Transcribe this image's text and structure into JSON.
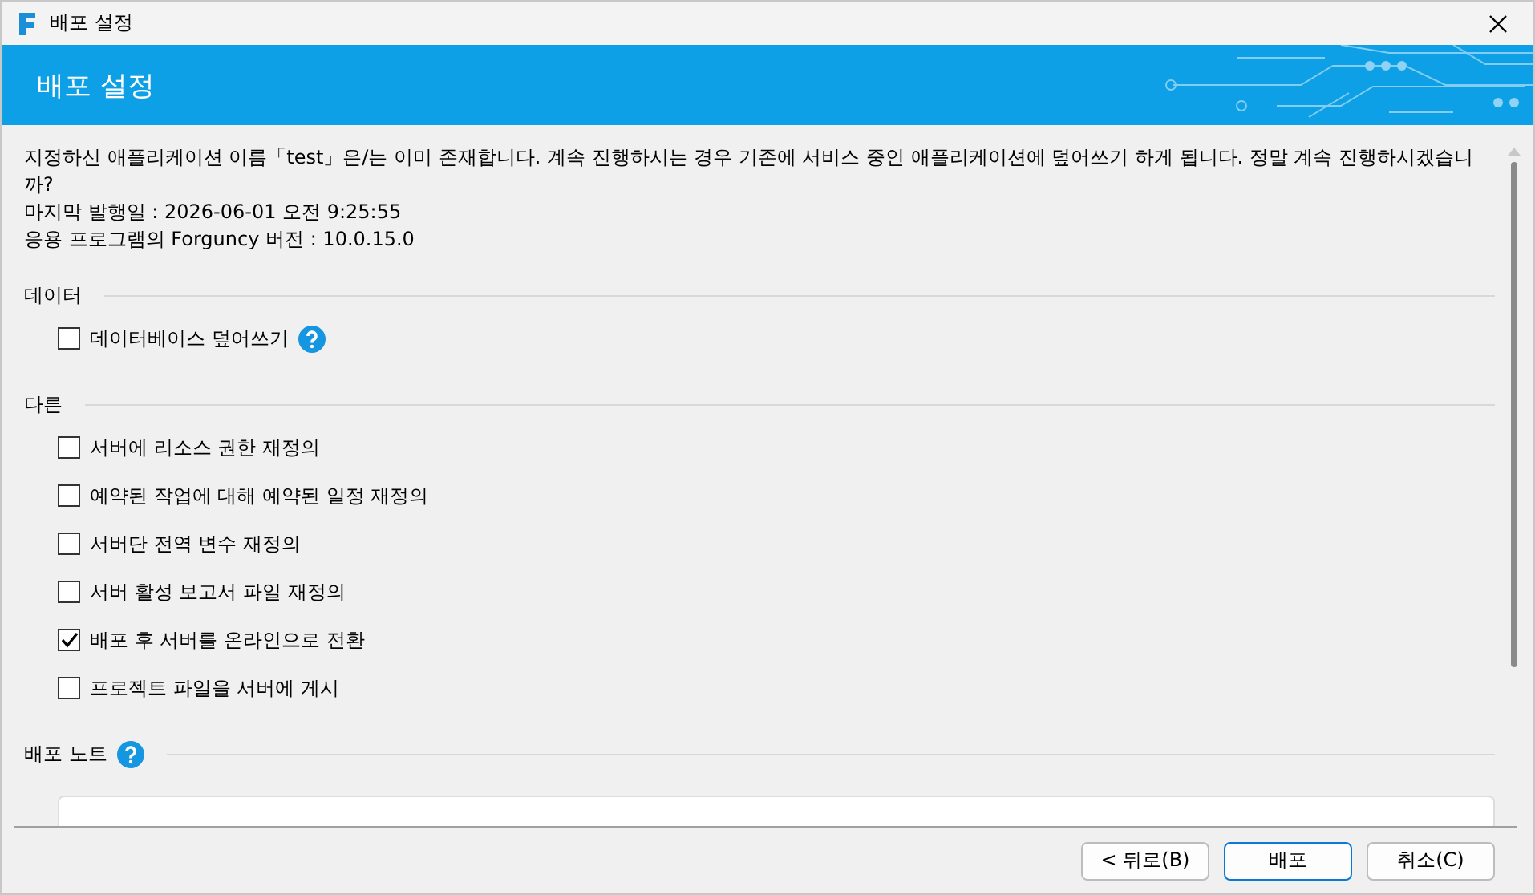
{
  "window": {
    "title": "배포 설정"
  },
  "banner": {
    "title": "배포 설정"
  },
  "message": [
    "지정하신 애플리케이션 이름「test」은/는 이미 존재합니다. 계속 진행하시는 경우 기존에 서비스 중인 애플리케이션에 덮어쓰기 하게 됩니다. 정말 계속 진행하시겠습니까?",
    "마지막 발행일 : 2026-06-01 오전 9:25:55",
    "응용 프로그램의 Forguncy 버전 : 10.0.15.0"
  ],
  "sections": [
    {
      "title": "데이터",
      "help": false,
      "options": [
        {
          "label": "데이터베이스 덮어쓰기",
          "checked": false,
          "help": true
        }
      ]
    },
    {
      "title": "다른",
      "help": false,
      "options": [
        {
          "label": "서버에 리소스 권한 재정의",
          "checked": false,
          "help": false
        },
        {
          "label": "예약된 작업에 대해 예약된 일정 재정의",
          "checked": false,
          "help": false
        },
        {
          "label": "서버단 전역 변수 재정의",
          "checked": false,
          "help": false
        },
        {
          "label": "서버 활성 보고서 파일 재정의",
          "checked": false,
          "help": false
        },
        {
          "label": "배포 후 서버를 온라인으로 전환",
          "checked": true,
          "help": false
        },
        {
          "label": "프로젝트 파일을 서버에 게시",
          "checked": false,
          "help": false
        }
      ]
    },
    {
      "title": "배포 노트",
      "help": true,
      "notes": true
    }
  ],
  "buttons": [
    {
      "label": "< 뒤로(B)",
      "primary": false
    },
    {
      "label": "배포",
      "primary": true
    },
    {
      "label": "취소(C)",
      "primary": false
    }
  ]
}
